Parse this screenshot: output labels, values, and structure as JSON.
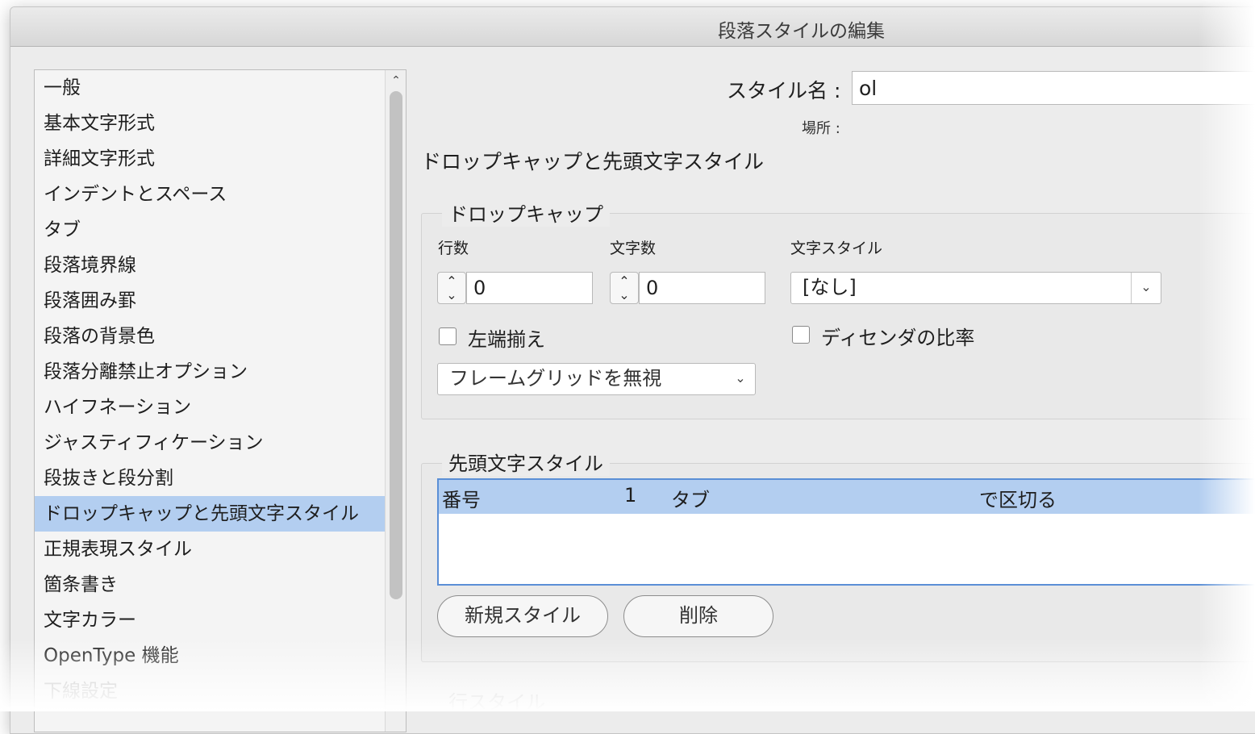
{
  "window": {
    "title": "段落スタイルの編集"
  },
  "sidebar": {
    "items": [
      {
        "label": "一般"
      },
      {
        "label": "基本文字形式"
      },
      {
        "label": "詳細文字形式"
      },
      {
        "label": "インデントとスペース"
      },
      {
        "label": "タブ"
      },
      {
        "label": "段落境界線"
      },
      {
        "label": "段落囲み罫"
      },
      {
        "label": "段落の背景色"
      },
      {
        "label": "段落分離禁止オプション"
      },
      {
        "label": "ハイフネーション"
      },
      {
        "label": "ジャスティフィケーション"
      },
      {
        "label": "段抜きと段分割"
      },
      {
        "label": "ドロップキャップと先頭文字スタイル",
        "selected": true
      },
      {
        "label": "正規表現スタイル"
      },
      {
        "label": "箇条書き"
      },
      {
        "label": "文字カラー"
      },
      {
        "label": "OpenType 機能"
      },
      {
        "label": "下線設定"
      }
    ]
  },
  "style_name": {
    "label": "スタイル名 :",
    "value": "ol"
  },
  "location": {
    "label": "場所 :"
  },
  "section_title": "ドロップキャップと先頭文字スタイル",
  "drop_cap": {
    "group_title": "ドロップキャップ",
    "lines_label": "行数",
    "lines_value": "0",
    "chars_label": "文字数",
    "chars_value": "0",
    "char_style_label": "文字スタイル",
    "char_style_value": "[なし]",
    "align_left_label": "左端揃え",
    "descender_label": "ディセンダの比率",
    "frame_grid_value": "フレームグリッドを無視"
  },
  "nested_styles": {
    "group_title": "先頭文字スタイル",
    "row": {
      "style": "番号",
      "count": "1",
      "char": "タブ",
      "mode": "で区切る"
    },
    "new_button": "新規スタイル",
    "delete_button": "削除"
  },
  "line_styles": {
    "group_title": "行スタイル"
  },
  "icons": {
    "up": "chevron-up-icon",
    "down": "chevron-down-icon"
  }
}
